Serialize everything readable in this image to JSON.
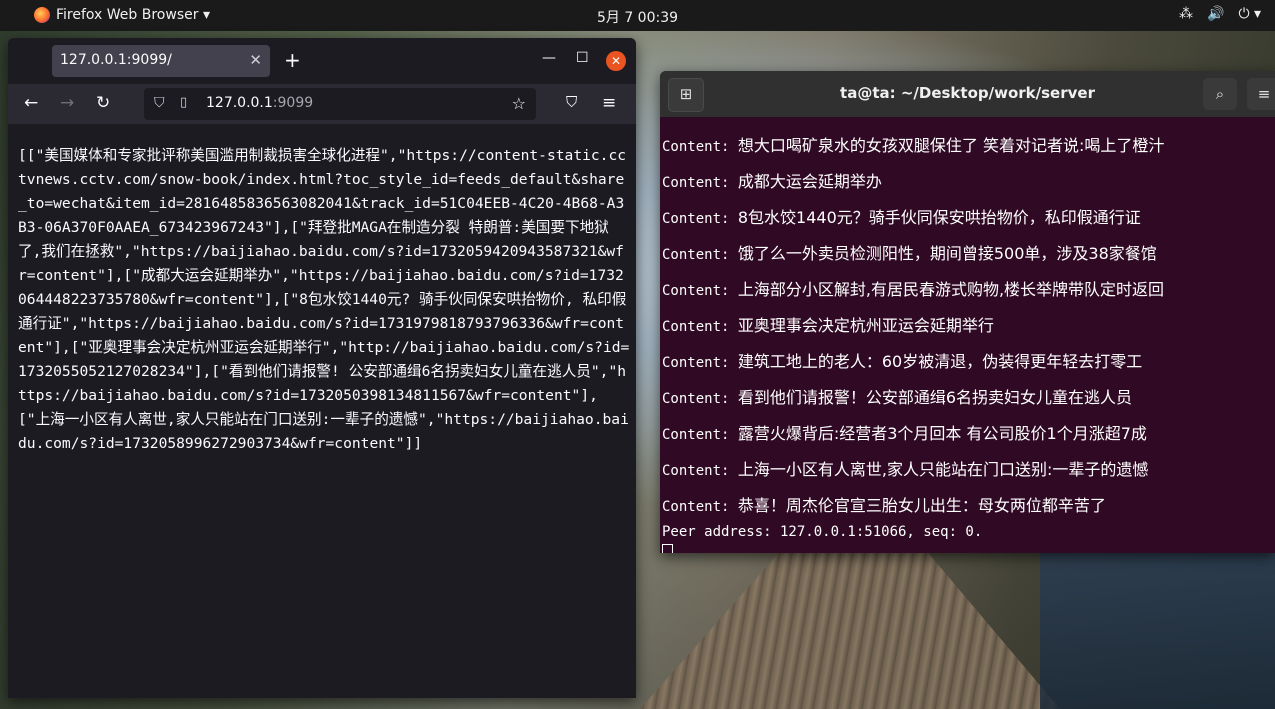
{
  "topbar": {
    "app_name": "Firefox Web Browser ▾",
    "clock": "5月 7  00:39",
    "tray_network": "⁂",
    "tray_volume": "🔊",
    "tray_power": "⏻ ▾"
  },
  "firefox": {
    "tab_title": "127.0.0.1:9099/",
    "tab_close": "✕",
    "new_tab": "+",
    "minimize": "—",
    "maximize": "☐",
    "close": "✕",
    "url_host": "127.0.0.1",
    "url_port": ":9099",
    "content": "[[\"美国媒体和专家批评称美国滥用制裁损害全球化进程\",\"https://content-static.cctvnews.cctv.com/snow-book/index.html?toc_style_id=feeds_default&share_to=wechat&item_id=2816485836563082041&track_id=51C04EEB-4C20-4B68-A3B3-06A370F0AAEA_673423967243\"],[\"拜登批MAGA在制造分裂 特朗普:美国要下地狱了,我们在拯救\",\"https://baijiahao.baidu.com/s?id=1732059420943587321&wfr=content\"],[\"成都大运会延期举办\",\"https://baijiahao.baidu.com/s?id=1732064448223735780&wfr=content\"],[\"8包水饺1440元? 骑手伙同保安哄抬物价, 私印假通行证\",\"https://baijiahao.baidu.com/s?id=1731979818793796336&wfr=content\"],[\"亚奥理事会决定杭州亚运会延期举行\",\"http://baijiahao.baidu.com/s?id=1732055052127028234\"],[\"看到他们请报警! 公安部通缉6名拐卖妇女儿童在逃人员\",\"https://baijiahao.baidu.com/s?id=1732050398134811567&wfr=content\"],[\"上海一小区有人离世,家人只能站在门口送别:一辈子的遗憾\",\"https://baijiahao.baidu.com/s?id=1732058996272903734&wfr=content\"]]"
  },
  "terminal": {
    "title": "ta@ta: ~/Desktop/work/server",
    "prefix": "Content: ",
    "lines": [
      "想大口喝矿泉水的女孩双腿保住了 笑着对记者说:喝上了橙汁",
      "成都大运会延期举办",
      "8包水饺1440元？骑手伙同保安哄抬物价，私印假通行证",
      "饿了么一外卖员检测阳性，期间曾接500单，涉及38家餐馆",
      "上海部分小区解封,有居民春游式购物,楼长举牌带队定时返回",
      "亚奥理事会决定杭州亚运会延期举行",
      "建筑工地上的老人：60岁被清退，伪装得更年轻去打零工",
      "看到他们请报警！公安部通缉6名拐卖妇女儿童在逃人员",
      "露营火爆背后:经营者3个月回本 有公司股价1个月涨超7成",
      "上海一小区有人离世,家人只能站在门口送别:一辈子的遗憾",
      "恭喜！周杰伦官宣三胎女儿出生：母女两位都辛苦了"
    ],
    "peer_line": "Peer address: 127.0.0.1:51066, seq: 0."
  }
}
